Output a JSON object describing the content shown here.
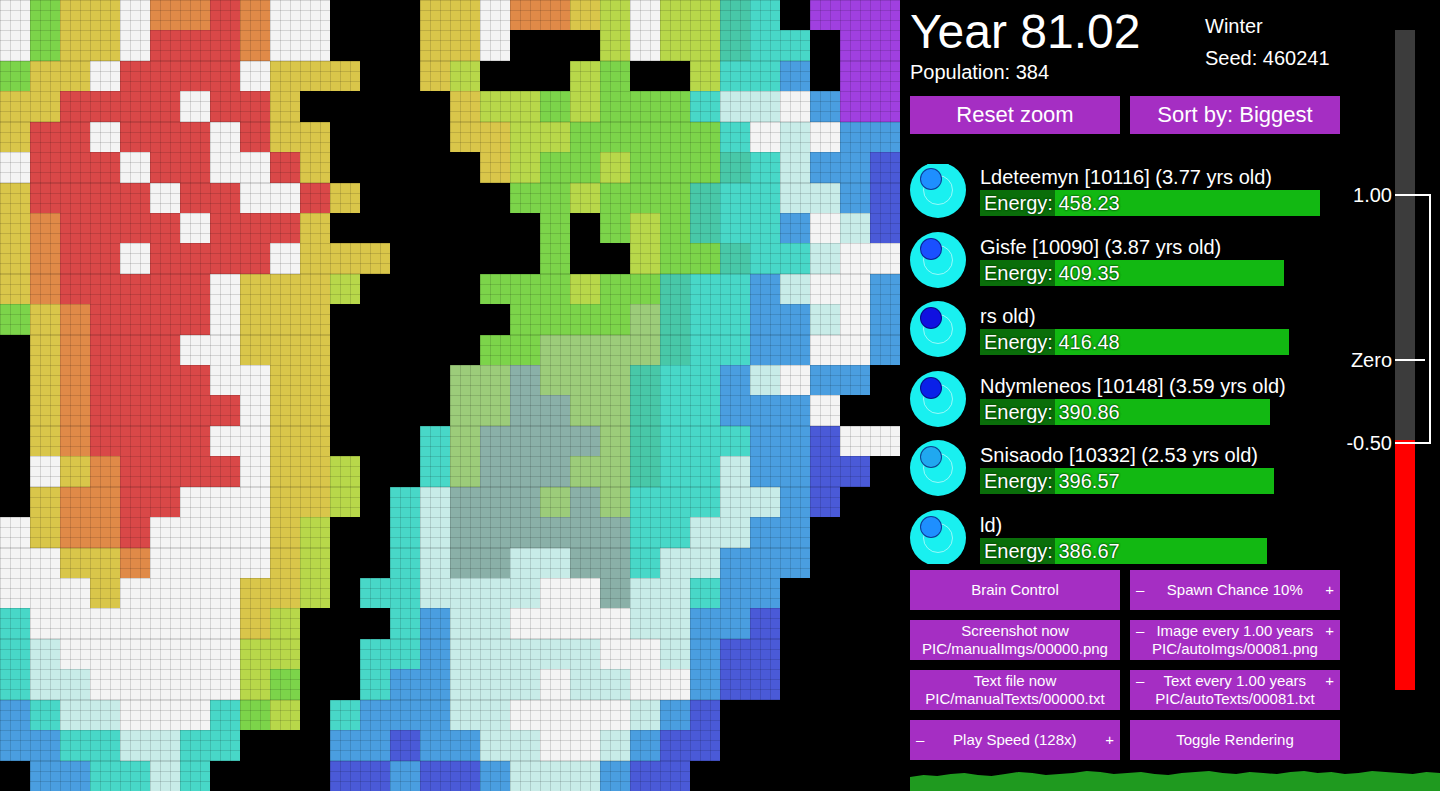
{
  "header": {
    "year": "Year 81.02",
    "season": "Winter",
    "seed": "Seed: 460241",
    "population": "Population: 384"
  },
  "top_buttons": [
    "Reset zoom",
    "Sort by: Biggest"
  ],
  "creatures": [
    {
      "name": "Ldeteemyn [10116] (3.77 yrs old)",
      "energy": "Energy: 458.23",
      "level": 0.986,
      "color": "#1e8fff"
    },
    {
      "name": "Gisfe [10090] (3.87 yrs old)",
      "energy": "Energy: 409.35",
      "level": 0.88,
      "color": "#1a50ff"
    },
    {
      "name": "rs old)",
      "energy": "Energy: 416.48",
      "level": 0.896,
      "color": "#1010e0"
    },
    {
      "name": "Ndymleneos [10148] (3.59 yrs old)",
      "energy": "Energy: 390.86",
      "level": 0.84,
      "color": "#0a20e8"
    },
    {
      "name": "Snisaodo [10332] (2.53 yrs old)",
      "energy": "Energy: 396.57",
      "level": 0.853,
      "color": "#20a8f0"
    },
    {
      "name": "ld)",
      "energy": "Energy: 386.67",
      "level": 0.832,
      "color": "#1e8fff"
    }
  ],
  "controls": [
    {
      "kind": "plain",
      "label": "Brain Control",
      "sublabel": ""
    },
    {
      "kind": "stepper",
      "minus": "–",
      "label": "Spawn Chance 10%",
      "plus": "+",
      "sublabel": ""
    },
    {
      "kind": "plain",
      "label": "Screenshot now",
      "sublabel": "PIC/manualImgs/00000.png"
    },
    {
      "kind": "stepper",
      "minus": "–",
      "label": "Image every 1.00 years",
      "plus": "+",
      "sublabel": "PIC/autoImgs/00081.png"
    },
    {
      "kind": "plain",
      "label": "Text file now",
      "sublabel": "PIC/manualTexts/00000.txt"
    },
    {
      "kind": "stepper",
      "minus": "–",
      "label": "Text every 1.00 years",
      "plus": "+",
      "sublabel": "PIC/autoTexts/00081.txt"
    },
    {
      "kind": "stepper",
      "minus": "–",
      "label": "Play Speed (128x)",
      "plus": "+",
      "sublabel": ""
    },
    {
      "kind": "plain",
      "label": "Toggle Rendering",
      "sublabel": ""
    }
  ],
  "thermometer": {
    "ticks": [
      {
        "label": "1.00",
        "value": 1
      },
      {
        "label": "Zero",
        "value": 0
      },
      {
        "label": "-0.50",
        "value": -0.5
      }
    ],
    "level": 0.379
  },
  "population_graph": {
    "values": [
      14,
      16,
      15,
      17,
      18,
      16,
      15,
      17,
      19,
      18,
      16,
      17,
      18,
      20,
      19,
      17,
      18,
      19,
      17,
      16,
      18,
      19,
      20,
      18,
      17,
      19,
      18,
      17,
      19,
      20,
      18,
      19,
      17,
      18,
      20,
      19,
      18,
      17,
      19,
      18
    ]
  },
  "map": {
    "palette": {
      "k": "#000000",
      "w": "#f4f4f4",
      "r": "#d94848",
      "o": "#e08a48",
      "y": "#d9c64a",
      "l": "#b8d84a",
      "g": "#7cd44a",
      "G": "#9ccc7a",
      "c": "#48d8c8",
      "b": "#4a9ee0",
      "B": "#4a5ad8",
      "p": "#a040e0",
      "s": "#8ab0a8",
      "t": "#48c8a8",
      "e": "#c8ece8"
    },
    "rows": [
      "wgyywoorowwkkkyywooylwlltckppp",
      "wgyywrrrowwkkkyywkkklwlltcckpp",
      "gyywrrrrwyyykkylkkklgkklccbkpp",
      "yyrrrrwrrykkkkkyllglgggceewbpp",
      "yrrwrrrwryykkkkyyllgggggcwewbb",
      "wrrrwrrwwrykkkkkylgglgggtcebbB",
      "yrrrrwrrwwrykkkkkgglgggtcceebB",
      "yorrrrwrrrykkkkkkkgkglgtccbweB",
      "yorrwrrrrwyyykkkkkgkklggtccewwB",
      "yorrrrrwyyylkkkkggglggtccbewwb",
      "gyorrrrwyyykkkkkkggggGtccbbewb",
      "kyorrrwwyyykkkkkggGGGGtccbbwwb",
      "kyorrrrwwyykkkkGGsGGGtccbewbbk",
      "kyorrrrrwyykkkkGGssGGtccbbbwkk",
      "kyorrrrwwyykkkcGssssGtcccbbBww",
      "kwyorrrrwyylkkcGsssGGtccebbBBk",
      "kyoorrwwwyylkcesssGsGccceebBkk",
      "wyoorwwwwylkkcesssssscceebbkkk",
      "wwyyowwwwylkkcesseessceebbbkkk",
      "wwwywwwwyylkcceeeewwseecbbkkkk",
      "cwwwwwwwylkkkcbeewwwweebbBkkkk",
      "cewwwwwwllkkccbeeeeewwebBBkkkk",
      "ceewwwwwlgkkcbbeeeweewwbBBkkkk",
      "bceewwwcglkcbbbeewwwwebBkkkkkk",
      "bbcceecckkkbbBbbeewwebBBkkkkkk",
      "kbbcceckkkkBBbBBbeeebBBkkkkkkk"
    ]
  }
}
